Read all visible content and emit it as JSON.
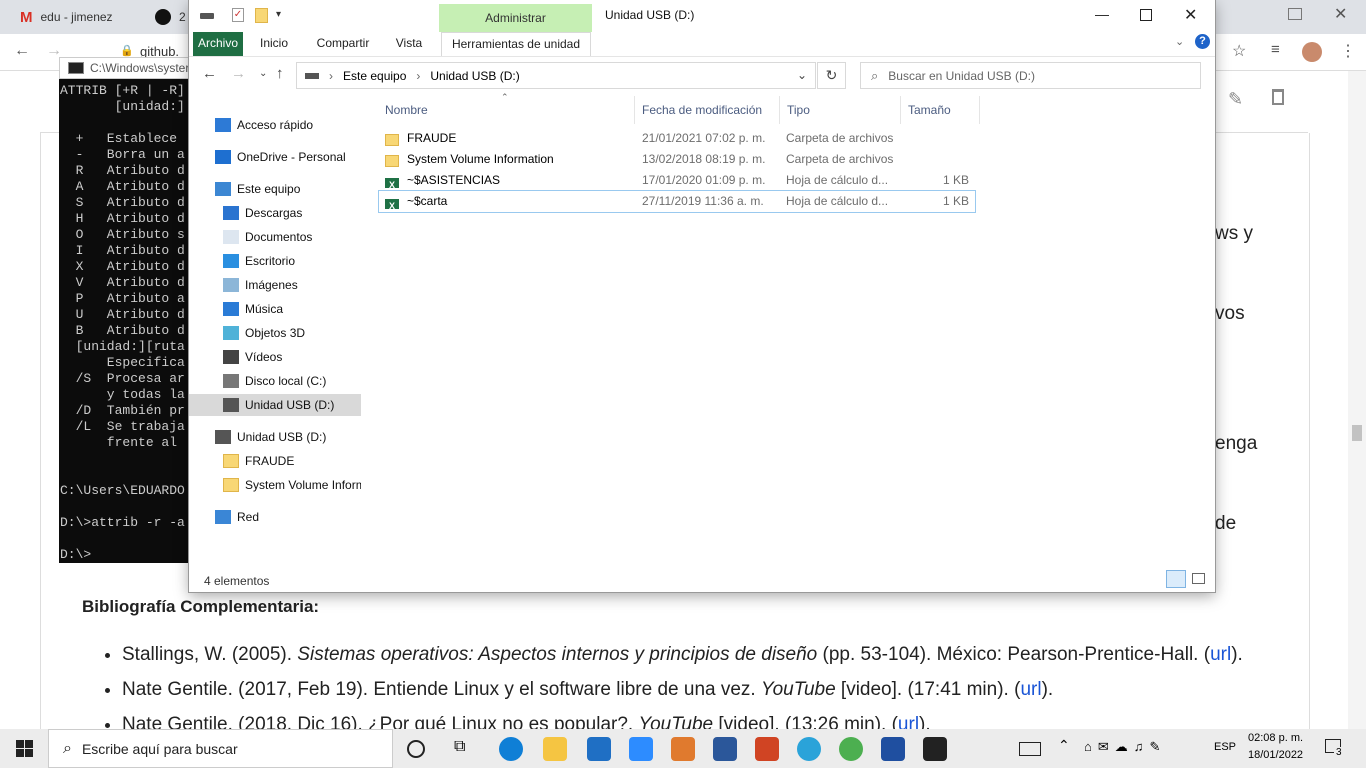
{
  "browser": {
    "tabs": [
      {
        "title": "edu - jimenez",
        "icon": "gmail-icon"
      },
      {
        "title": "2",
        "icon": "github-icon"
      }
    ],
    "address_fragment": "github."
  },
  "webpage": {
    "right_fragments": [
      "ws y",
      "vos",
      "enga",
      "de"
    ],
    "biblio_heading": "Bibliografía Complementaria:",
    "biblio_items": [
      {
        "text": "Stallings, W. (2005). ",
        "italic": "Sistemas operativos: Aspectos internos y principios de diseño",
        "rest": " (pp. 53-104). México: Pearson-Prentice-Hall. (",
        "link": "url",
        "end": ")."
      },
      {
        "text": "Nate Gentile. (2017, Feb 19). Entiende Linux y el software libre de una vez. ",
        "italic": "YouTube",
        "rest": " [video]. (17:41 min). (",
        "link": "url",
        "end": ")."
      },
      {
        "text": "Nate Gentile. (2018, Dic 16). ¿Por qué Linux no es popular?. ",
        "italic": "YouTube",
        "rest": " [video]. (13:26 min). (",
        "link": "url",
        "end": ")."
      }
    ]
  },
  "cmd": {
    "title": "C:\\Windows\\syster",
    "lines": [
      "ATTRIB [+R | -R]",
      "       [unidad:]",
      "",
      "  +   Establece",
      "  -   Borra un a",
      "  R   Atributo d",
      "  A   Atributo d",
      "  S   Atributo d",
      "  H   Atributo d",
      "  O   Atributo s",
      "  I   Atributo d",
      "  X   Atributo d",
      "  V   Atributo d",
      "  P   Atributo a",
      "  U   Atributo d",
      "  B   Atributo d",
      "  [unidad:][ruta",
      "      Especifica",
      "  /S  Procesa ar",
      "      y todas la",
      "  /D  También pr",
      "  /L  Se trabaja",
      "      frente al",
      "",
      "",
      "C:\\Users\\EDUARDO",
      "",
      "D:\\>attrib -r -a",
      "",
      "D:\\>"
    ]
  },
  "explorer": {
    "title": "Unidad USB (D:)",
    "contextual_group": "Administrar",
    "ribbon_tabs": [
      "Archivo",
      "Inicio",
      "Compartir",
      "Vista",
      "Herramientas de unidad"
    ],
    "breadcrumb": [
      "Este equipo",
      "Unidad USB (D:)"
    ],
    "search_placeholder": "Buscar en Unidad USB (D:)",
    "nav_items": [
      {
        "label": "Acceso rápido",
        "icon": "star-icon",
        "indent": 0
      },
      {
        "label": "OneDrive - Personal",
        "icon": "cloud-icon",
        "indent": 0
      },
      {
        "label": "Este equipo",
        "icon": "computer-icon",
        "indent": 0
      },
      {
        "label": "Descargas",
        "icon": "download-icon",
        "indent": 1
      },
      {
        "label": "Documentos",
        "icon": "document-icon",
        "indent": 1
      },
      {
        "label": "Escritorio",
        "icon": "desktop-icon",
        "indent": 1
      },
      {
        "label": "Imágenes",
        "icon": "pictures-icon",
        "indent": 1
      },
      {
        "label": "Música",
        "icon": "music-icon",
        "indent": 1
      },
      {
        "label": "Objetos 3D",
        "icon": "cube-icon",
        "indent": 1
      },
      {
        "label": "Vídeos",
        "icon": "video-icon",
        "indent": 1
      },
      {
        "label": "Disco local (C:)",
        "icon": "disk-icon",
        "indent": 1
      },
      {
        "label": "Unidad USB (D:)",
        "icon": "usb-drive-icon",
        "indent": 1,
        "selected": true
      },
      {
        "label": "Unidad USB (D:)",
        "icon": "usb-drive-icon",
        "indent": 0
      },
      {
        "label": "FRAUDE",
        "icon": "folder-icon",
        "indent": 1
      },
      {
        "label": "System Volume Inform",
        "icon": "folder-icon",
        "indent": 1
      },
      {
        "label": "Red",
        "icon": "network-icon",
        "indent": 0
      }
    ],
    "columns": [
      "Nombre",
      "Fecha de modificación",
      "Tipo",
      "Tamaño"
    ],
    "files": [
      {
        "name": "FRAUDE",
        "date": "21/01/2021 07:02 p. m.",
        "type": "Carpeta de archivos",
        "size": "",
        "icon": "folder-icon"
      },
      {
        "name": "System Volume Information",
        "date": "13/02/2018 08:19 p. m.",
        "type": "Carpeta de archivos",
        "size": "",
        "icon": "folder-icon"
      },
      {
        "name": "~$ASISTENCIAS",
        "date": "17/01/2020 01:09 p. m.",
        "type": "Hoja de cálculo d...",
        "size": "1 KB",
        "icon": "excel-icon"
      },
      {
        "name": "~$carta",
        "date": "27/11/2019 11:36 a. m.",
        "type": "Hoja de cálculo d...",
        "size": "1 KB",
        "icon": "excel-icon"
      }
    ],
    "status": "4 elementos"
  },
  "taskbar": {
    "search_placeholder": "Escribe aquí para buscar",
    "language": "ESP",
    "time": "02:08 p. m.",
    "date": "18/01/2022",
    "notification_count": "3"
  }
}
